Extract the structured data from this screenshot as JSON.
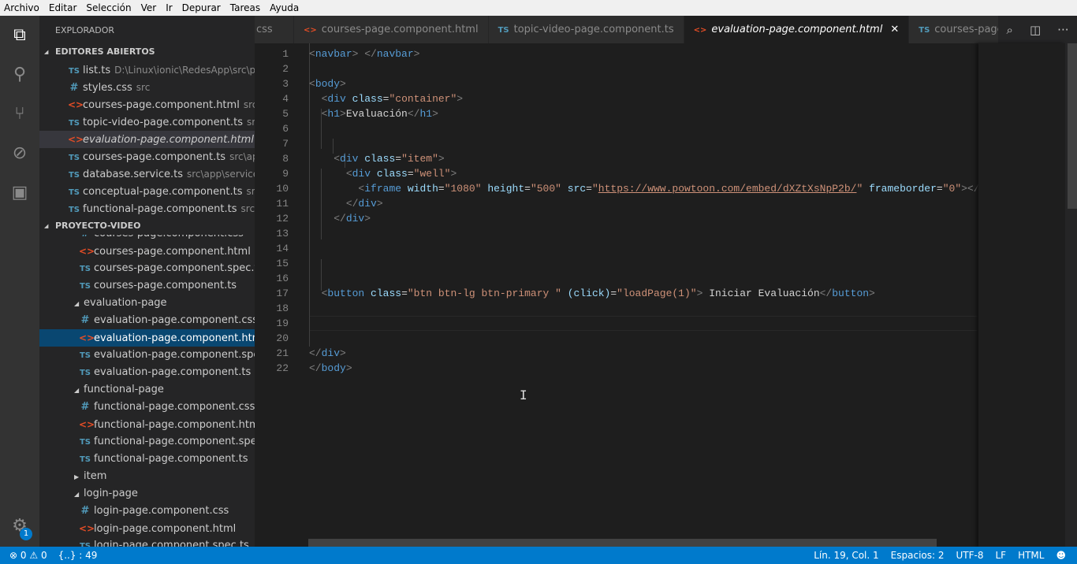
{
  "menu": [
    "Archivo",
    "Editar",
    "Selección",
    "Ver",
    "Ir",
    "Depurar",
    "Tareas",
    "Ayuda"
  ],
  "activity_icons": [
    "files-icon",
    "search-icon",
    "source-control-icon",
    "debug-icon",
    "extensions-icon"
  ],
  "settings_badge": "1",
  "sidebar": {
    "title": "EXPLORADOR",
    "open_editors_title": "EDITORES ABIERTOS",
    "open_editors": [
      {
        "icon": "ts",
        "label": "list.ts",
        "desc": "D:\\Linux\\ionic\\RedesApp\\src\\pag..."
      },
      {
        "icon": "css",
        "label": "styles.css",
        "desc": "src"
      },
      {
        "icon": "html",
        "label": "courses-page.component.html",
        "desc": "src\\a..."
      },
      {
        "icon": "ts",
        "label": "topic-video-page.component.ts",
        "desc": "src\\..."
      },
      {
        "icon": "html",
        "label": "evaluation-page.component.html",
        "desc": "src...",
        "italic": true,
        "selected": true
      },
      {
        "icon": "ts",
        "label": "courses-page.component.ts",
        "desc": "src\\app\\..."
      },
      {
        "icon": "ts",
        "label": "database.service.ts",
        "desc": "src\\app\\services"
      },
      {
        "icon": "ts",
        "label": "conceptual-page.component.ts",
        "desc": "src\\a..."
      },
      {
        "icon": "ts",
        "label": "functional-page.component.ts",
        "desc": "src\\ap..."
      }
    ],
    "project_title": "PROYECTO-VIDEO",
    "tree": [
      {
        "icon": "css",
        "label": "courses-page.component.css",
        "depth": 2
      },
      {
        "icon": "html",
        "label": "courses-page.component.html",
        "depth": 2
      },
      {
        "icon": "ts",
        "label": "courses-page.component.spec.ts",
        "depth": 2
      },
      {
        "icon": "ts",
        "label": "courses-page.component.ts",
        "depth": 2
      },
      {
        "folder": "open",
        "label": "evaluation-page",
        "depth": 1
      },
      {
        "icon": "css",
        "label": "evaluation-page.component.css",
        "depth": 2
      },
      {
        "icon": "html",
        "label": "evaluation-page.component.html",
        "depth": 2,
        "active": true
      },
      {
        "icon": "ts",
        "label": "evaluation-page.component.spec.ts",
        "depth": 2
      },
      {
        "icon": "ts",
        "label": "evaluation-page.component.ts",
        "depth": 2
      },
      {
        "folder": "open",
        "label": "functional-page",
        "depth": 1
      },
      {
        "icon": "css",
        "label": "functional-page.component.css",
        "depth": 2
      },
      {
        "icon": "html",
        "label": "functional-page.component.html",
        "depth": 2
      },
      {
        "icon": "ts",
        "label": "functional-page.component.spec.ts",
        "depth": 2
      },
      {
        "icon": "ts",
        "label": "functional-page.component.ts",
        "depth": 2
      },
      {
        "folder": "closed",
        "label": "item",
        "depth": 1
      },
      {
        "folder": "open",
        "label": "login-page",
        "depth": 1
      },
      {
        "icon": "css",
        "label": "login-page.component.css",
        "depth": 2
      },
      {
        "icon": "html",
        "label": "login-page.component.html",
        "depth": 2
      },
      {
        "icon": "ts",
        "label": "login-page.component.spec.ts",
        "depth": 2
      }
    ]
  },
  "tabs": [
    {
      "icon": "css",
      "label": "css"
    },
    {
      "icon": "html",
      "label": "courses-page.component.html"
    },
    {
      "icon": "ts",
      "label": "topic-video-page.component.ts"
    },
    {
      "icon": "html",
      "label": "evaluation-page.component.html",
      "active": true
    },
    {
      "icon": "ts",
      "label": "courses-page.componen"
    }
  ],
  "icon_glyphs": {
    "ts": "TS",
    "css": "#",
    "html": "<>"
  },
  "cursor_line": 19,
  "code": [
    [
      [
        "b",
        "<"
      ],
      [
        "n",
        "navbar"
      ],
      [
        "b",
        "> </"
      ],
      [
        "n",
        "navbar"
      ],
      [
        "b",
        ">"
      ]
    ],
    [],
    [
      [
        "b",
        "<"
      ],
      [
        "n",
        "body"
      ],
      [
        "b",
        ">"
      ]
    ],
    [
      [
        "x",
        "  "
      ],
      [
        "b",
        "<"
      ],
      [
        "n",
        "div"
      ],
      [
        "x",
        " "
      ],
      [
        "a",
        "class"
      ],
      [
        "x",
        "="
      ],
      [
        "s",
        "\"container\""
      ],
      [
        "b",
        ">"
      ]
    ],
    [
      [
        "x",
        "  "
      ],
      [
        "b",
        "<"
      ],
      [
        "n",
        "h1"
      ],
      [
        "b",
        ">"
      ],
      [
        "x",
        "Evaluación"
      ],
      [
        "b",
        "</"
      ],
      [
        "n",
        "h1"
      ],
      [
        "b",
        ">"
      ]
    ],
    [],
    [],
    [
      [
        "x",
        "    "
      ],
      [
        "b",
        "<"
      ],
      [
        "n",
        "div"
      ],
      [
        "x",
        " "
      ],
      [
        "a",
        "class"
      ],
      [
        "x",
        "="
      ],
      [
        "s",
        "\"item\""
      ],
      [
        "b",
        ">"
      ]
    ],
    [
      [
        "x",
        "      "
      ],
      [
        "b",
        "<"
      ],
      [
        "n",
        "div"
      ],
      [
        "x",
        " "
      ],
      [
        "a",
        "class"
      ],
      [
        "x",
        "="
      ],
      [
        "s",
        "\"well\""
      ],
      [
        "b",
        ">"
      ]
    ],
    [
      [
        "x",
        "        "
      ],
      [
        "b",
        "<"
      ],
      [
        "n",
        "iframe"
      ],
      [
        "x",
        " "
      ],
      [
        "a",
        "width"
      ],
      [
        "x",
        "="
      ],
      [
        "s",
        "\"1080\""
      ],
      [
        "x",
        " "
      ],
      [
        "a",
        "height"
      ],
      [
        "x",
        "="
      ],
      [
        "s",
        "\"500\""
      ],
      [
        "x",
        " "
      ],
      [
        "a",
        "src"
      ],
      [
        "x",
        "="
      ],
      [
        "s",
        "\""
      ],
      [
        "u",
        "https://www.powtoon.com/embed/dXZtXsNpP2b/"
      ],
      [
        "s",
        "\""
      ],
      [
        "x",
        " "
      ],
      [
        "a",
        "frameborder"
      ],
      [
        "x",
        "="
      ],
      [
        "s",
        "\"0\""
      ],
      [
        "b",
        "></"
      ],
      [
        "n",
        "iframe"
      ],
      [
        "b",
        ">"
      ]
    ],
    [
      [
        "x",
        "      "
      ],
      [
        "b",
        "</"
      ],
      [
        "n",
        "div"
      ],
      [
        "b",
        ">"
      ]
    ],
    [
      [
        "x",
        "    "
      ],
      [
        "b",
        "</"
      ],
      [
        "n",
        "div"
      ],
      [
        "b",
        ">"
      ]
    ],
    [],
    [],
    [],
    [],
    [
      [
        "x",
        "  "
      ],
      [
        "b",
        "<"
      ],
      [
        "n",
        "button"
      ],
      [
        "x",
        " "
      ],
      [
        "a",
        "class"
      ],
      [
        "x",
        "="
      ],
      [
        "s",
        "\"btn btn-lg btn-primary \""
      ],
      [
        "x",
        " "
      ],
      [
        "a",
        "(click)"
      ],
      [
        "x",
        "="
      ],
      [
        "s",
        "\"loadPage(1)\""
      ],
      [
        "b",
        ">"
      ],
      [
        "x",
        " Iniciar Evaluación"
      ],
      [
        "b",
        "</"
      ],
      [
        "n",
        "button"
      ],
      [
        "b",
        ">"
      ]
    ],
    [],
    [],
    [],
    [
      [
        "b",
        "</"
      ],
      [
        "n",
        "div"
      ],
      [
        "b",
        ">"
      ]
    ],
    [
      [
        "b",
        "</"
      ],
      [
        "n",
        "body"
      ],
      [
        "b",
        ">"
      ]
    ]
  ],
  "status": {
    "errors": "0",
    "warnings": "0",
    "symbols": "{..} : 49",
    "position": "Lín. 19, Col. 1",
    "indent": "Espacios: 2",
    "encoding": "UTF-8",
    "eol": "LF",
    "language": "HTML"
  },
  "colors": {
    "accent": "#007acc",
    "tag": "#569cd6",
    "attribute": "#9cdcfe",
    "string": "#ce9178"
  }
}
